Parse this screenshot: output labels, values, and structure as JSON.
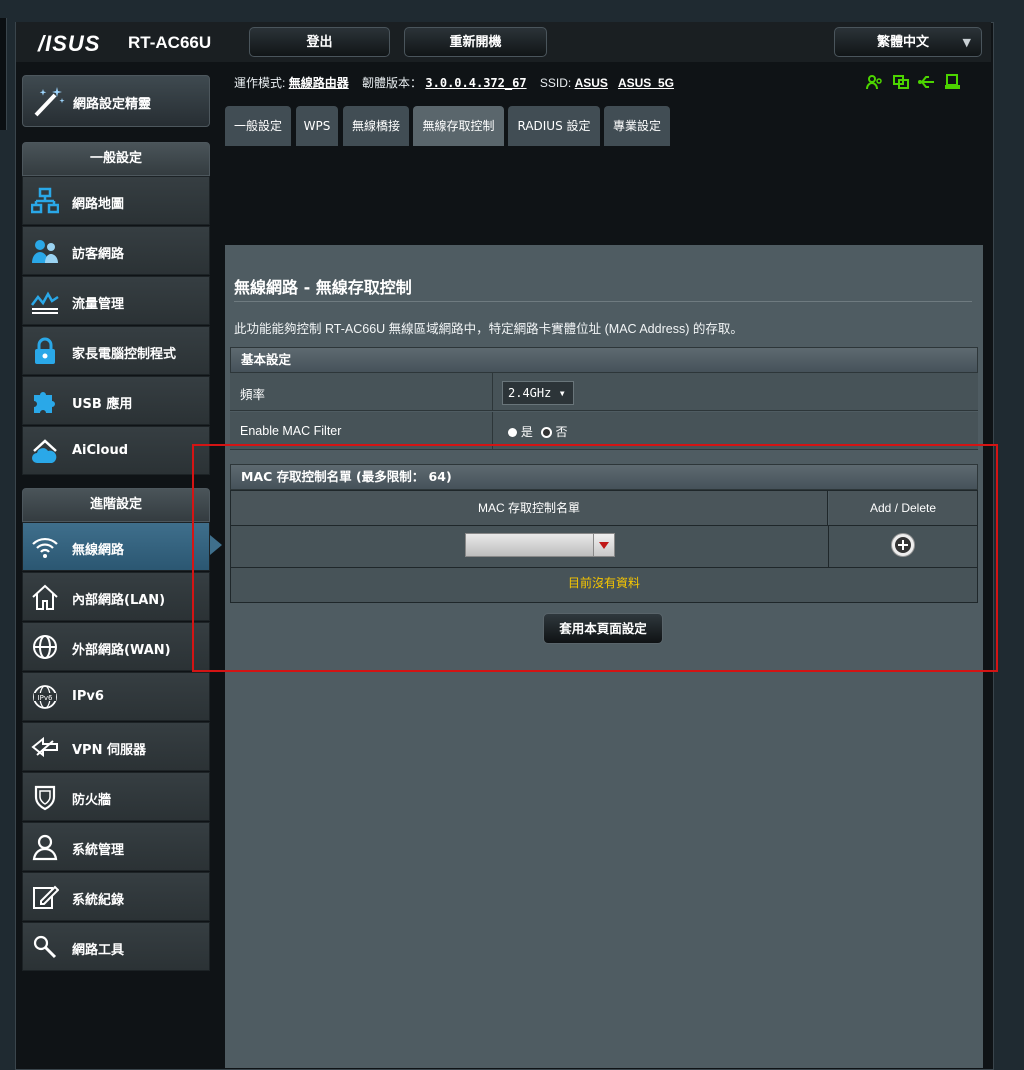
{
  "header": {
    "brand": "/ISUS",
    "model": "RT-AC66U",
    "logout_label": "登出",
    "reboot_label": "重新開機",
    "language": "繁體中文"
  },
  "info": {
    "mode_label": "運作模式:",
    "mode_value": "無線路由器",
    "firmware_label": "韌體版本：",
    "firmware_value": "3.0.0.4.372_67",
    "ssid_label": "SSID:",
    "ssid_1": "ASUS",
    "ssid_2": "ASUS_5G",
    "status_icons": [
      "users-icon",
      "network-copy-icon",
      "usb-icon",
      "printer-icon"
    ],
    "status_color": "#4cd400"
  },
  "tabs": [
    {
      "label": "一般設定"
    },
    {
      "label": "WPS"
    },
    {
      "label": "無線橋接"
    },
    {
      "label": "無線存取控制",
      "active": true
    },
    {
      "label": "RADIUS 設定"
    },
    {
      "label": "專業設定"
    }
  ],
  "sidebar": {
    "wizard_label": "網路設定精靈",
    "general_header": "一般設定",
    "general_items": [
      {
        "label": "網路地圖",
        "icon": "network-map-icon"
      },
      {
        "label": "訪客網路",
        "icon": "guest-network-icon"
      },
      {
        "label": "流量管理",
        "icon": "traffic-icon"
      },
      {
        "label": "家長電腦控制程式",
        "icon": "lock-icon"
      },
      {
        "label": "USB 應用",
        "icon": "puzzle-icon"
      },
      {
        "label": "AiCloud",
        "icon": "cloud-home-icon"
      }
    ],
    "advanced_header": "進階設定",
    "advanced_items": [
      {
        "label": "無線網路",
        "icon": "wifi-icon",
        "active": true
      },
      {
        "label": "內部網路(LAN)",
        "icon": "home-icon"
      },
      {
        "label": "外部網路(WAN)",
        "icon": "globe-icon"
      },
      {
        "label": "IPv6",
        "icon": "ipv6-icon"
      },
      {
        "label": "VPN 伺服器",
        "icon": "vpn-icon"
      },
      {
        "label": "防火牆",
        "icon": "shield-icon"
      },
      {
        "label": "系統管理",
        "icon": "user-icon"
      },
      {
        "label": "系統紀錄",
        "icon": "log-edit-icon"
      },
      {
        "label": "網路工具",
        "icon": "tools-icon"
      }
    ]
  },
  "content": {
    "title": "無線網路 - 無線存取控制",
    "description": "此功能能夠控制 RT-AC66U 無線區域網路中，特定網路卡實體位址 (MAC Address) 的存取。",
    "basic_header": "基本設定",
    "frequency_label": "頻率",
    "frequency_value": "2.4GHz ▾",
    "mac_filter_label": "Enable MAC Filter",
    "radio_yes": "是",
    "radio_no": "否",
    "mac_filter_selected": "否",
    "list_header": "MAC 存取控制名單 (最多限制： 64)",
    "col_list": "MAC 存取控制名單",
    "col_action": "Add / Delete",
    "empty_text": "目前沒有資料",
    "apply_label": "套用本頁面設定"
  }
}
